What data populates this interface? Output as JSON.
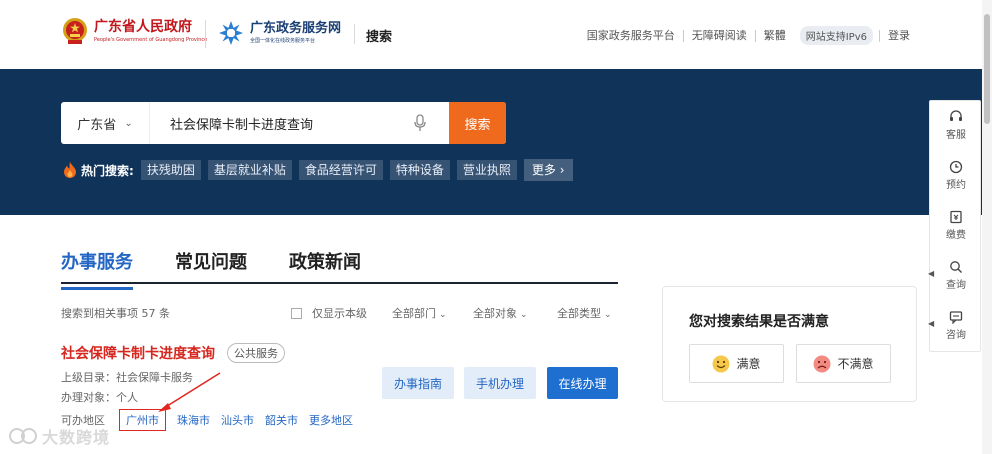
{
  "header": {
    "gov_title": "广东省人民政府",
    "gov_subtitle": "People's Government of Guangdong Province",
    "service_title": "广东政务服务网",
    "service_subtitle": "全国一体化在线政务服务平台",
    "page_label": "搜索",
    "links": [
      "国家政务服务平台",
      "无障碍阅读",
      "繁體"
    ],
    "ipv6_badge": "网站支持IPv6",
    "login": "登录"
  },
  "search": {
    "region": "广东省",
    "query": "社会保障卡制卡进度查询",
    "button": "搜索",
    "hot_label": "热门搜索:",
    "hot_tags": [
      "扶残助困",
      "基层就业补贴",
      "食品经营许可",
      "特种设备",
      "营业执照"
    ],
    "more": "更多"
  },
  "tabs": [
    "办事服务",
    "常见问题",
    "政策新闻"
  ],
  "results": {
    "count_text": "搜索到相关事项 57 条",
    "only_local": "仅显示本级",
    "filters": [
      "全部部门",
      "全部对象",
      "全部类型"
    ]
  },
  "item": {
    "title": "社会保障卡制卡进度查询",
    "badge": "公共服务",
    "parent_dir": "上级目录：社会保障卡服务",
    "target": "办理对象：个人",
    "areas_label": "可办地区",
    "areas": [
      "广州市",
      "珠海市",
      "汕头市",
      "韶关市",
      "更多地区"
    ],
    "buttons": [
      "办事指南",
      "手机办理",
      "在线办理"
    ]
  },
  "satisfaction": {
    "title": "您对搜索结果是否满意",
    "satisfied": "满意",
    "unsatisfied": "不满意"
  },
  "float_bar": [
    "客服",
    "预约",
    "缴费",
    "查询",
    "咨询"
  ],
  "watermark": "大数跨境",
  "colors": {
    "banner": "#10335a",
    "accent_blue": "#2466c4",
    "search_orange": "#f06a1d",
    "title_red": "#d7261e"
  }
}
